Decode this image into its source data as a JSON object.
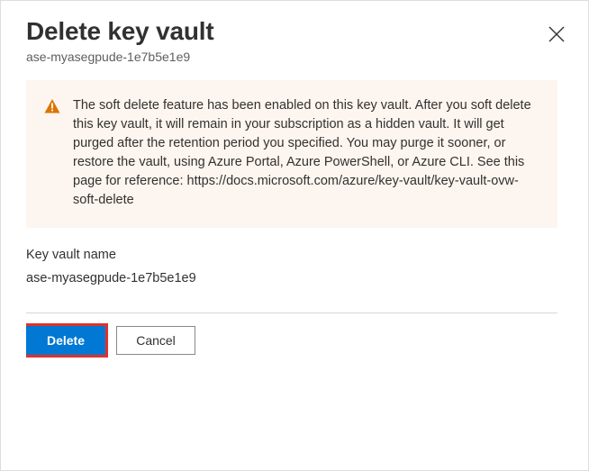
{
  "header": {
    "title": "Delete key vault",
    "subtitle": "ase-myasegpude-1e7b5e1e9"
  },
  "warning": {
    "text": "The soft delete feature has been enabled on this key vault. After you soft delete this key vault, it will remain in your subscription as a hidden vault. It will get purged after the retention period you specified. You may purge it sooner, or restore the vault, using Azure Portal, Azure PowerShell, or Azure CLI. See this page for reference: https://docs.microsoft.com/azure/key-vault/key-vault-ovw-soft-delete"
  },
  "field": {
    "label": "Key vault name",
    "value": "ase-myasegpude-1e7b5e1e9"
  },
  "actions": {
    "delete_label": "Delete",
    "cancel_label": "Cancel"
  }
}
